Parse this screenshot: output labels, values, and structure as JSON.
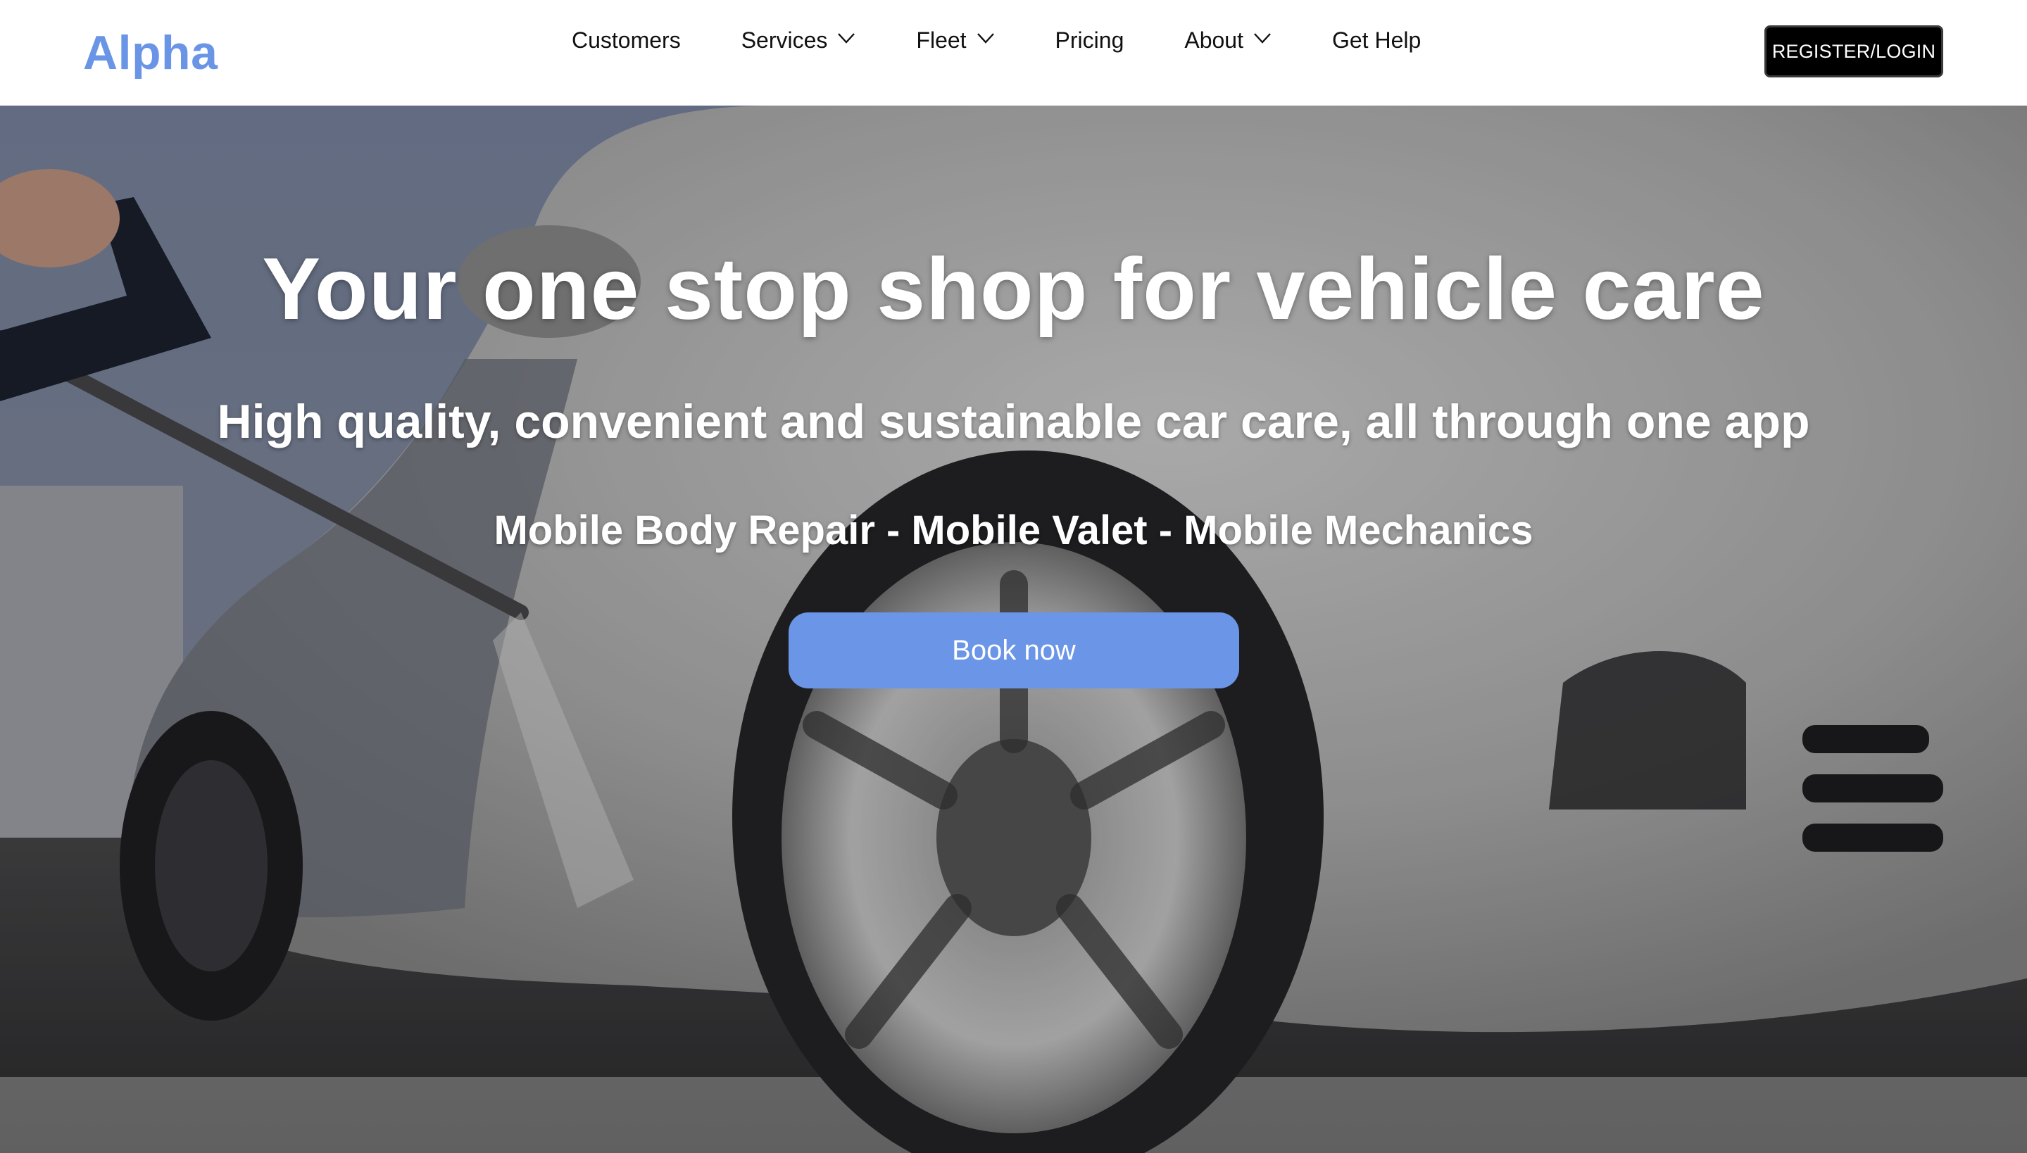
{
  "header": {
    "logo": "Alpha",
    "nav": [
      {
        "label": "Customers",
        "dropdown": false
      },
      {
        "label": "Services",
        "dropdown": true
      },
      {
        "label": "Fleet",
        "dropdown": true
      },
      {
        "label": "Pricing",
        "dropdown": false
      },
      {
        "label": "About",
        "dropdown": true
      },
      {
        "label": "Get Help",
        "dropdown": false
      }
    ],
    "register_label": "REGISTER/LOGIN"
  },
  "hero": {
    "title": "Your one stop shop for vehicle care",
    "subtitle": "High quality, convenient and sustainable car care, all through one app",
    "services": "Mobile Body Repair - Mobile Valet - Mobile Mechanics",
    "cta_label": "Book now"
  },
  "colors": {
    "brand": "#6a95e6",
    "cta": "#6b95e6",
    "register_bg": "#000000"
  }
}
